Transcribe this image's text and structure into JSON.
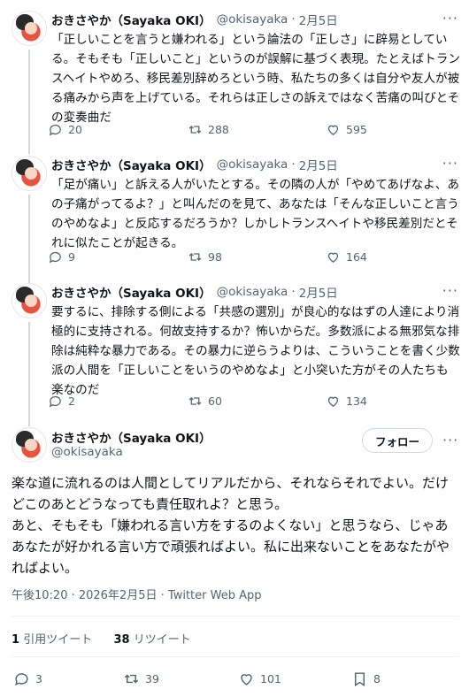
{
  "tweets": [
    {
      "name": "おきさやか（Sayaka OKI）",
      "handle": "@okisayaka",
      "date": "2月5日",
      "text": "「正しいことを言うと嫌われる」という論法の「正しさ」に辟易としている。そもそも「正しいこと」というのが誤解に基づく表現。たとえばトランスヘイトやめろ、移民差別辞めろという時、私たちの多くは自分や友人が被る痛みから声を上げている。それらは正しさの訴えではなく苦痛の叫びとその変奏曲だ",
      "replies": "20",
      "retweets": "288",
      "likes": "595"
    },
    {
      "name": "おきさやか（Sayaka OKI）",
      "handle": "@okisayaka",
      "date": "2月5日",
      "text": "「足が痛い」と訴える人がいたとする。その隣の人が「やめてあげなよ、あの子痛がってるよ？」と叫んだのを見て、あなたは「そんな正しいこと言うのやめなよ」と反応するだろうか？しかしトランスヘイトや移民差別だとそれに似たことが起きる。",
      "replies": "9",
      "retweets": "98",
      "likes": "164"
    },
    {
      "name": "おきさやか（Sayaka OKI）",
      "handle": "@okisayaka",
      "date": "2月5日",
      "text": "要するに、排除する側による「共感の選別」が良心的なはずの人達により消極的に支持される。何故支持するか？怖いからだ。多数派による無邪気な排除は純粋な暴力である。その暴力に逆らうよりは、こういうことを書く少数派の人間を「正しいことをいうのやめなよ」と小突いた方がその人たちも楽なのだ",
      "replies": "2",
      "retweets": "60",
      "likes": "134"
    }
  ],
  "main": {
    "name": "おきさやか（Sayaka OKI）",
    "handle": "@okisayaka",
    "follow_label": "フォロー",
    "text": "楽な道に流れるのは人間としてリアルだから、それならそれでよい。だけどこのあとどうなっても責任取れよ？と思う。\nあと、そもそも「嫌われる言い方をするのよくない」と思うなら、じゃああなたが好かれる言い方で頑張ればよい。私に出来ないことをあなたがやればよい。",
    "time": "午後10:20 · 2026年2月5日",
    "client": "Twitter Web App",
    "quote_count": "1",
    "quote_label": "引用ツイート",
    "retweet_count": "38",
    "retweet_label": "リツイート",
    "replies": "3",
    "retweets": "39",
    "likes": "101",
    "bookmarks": "8"
  },
  "ui": {
    "more": "···",
    "separator": "·"
  },
  "icons": [
    "reply-icon",
    "retweet-icon",
    "like-icon",
    "bookmark-icon",
    "more-icon"
  ],
  "colors": {
    "text": "#0f1419",
    "muted": "#536471",
    "border": "#cfd9de"
  }
}
